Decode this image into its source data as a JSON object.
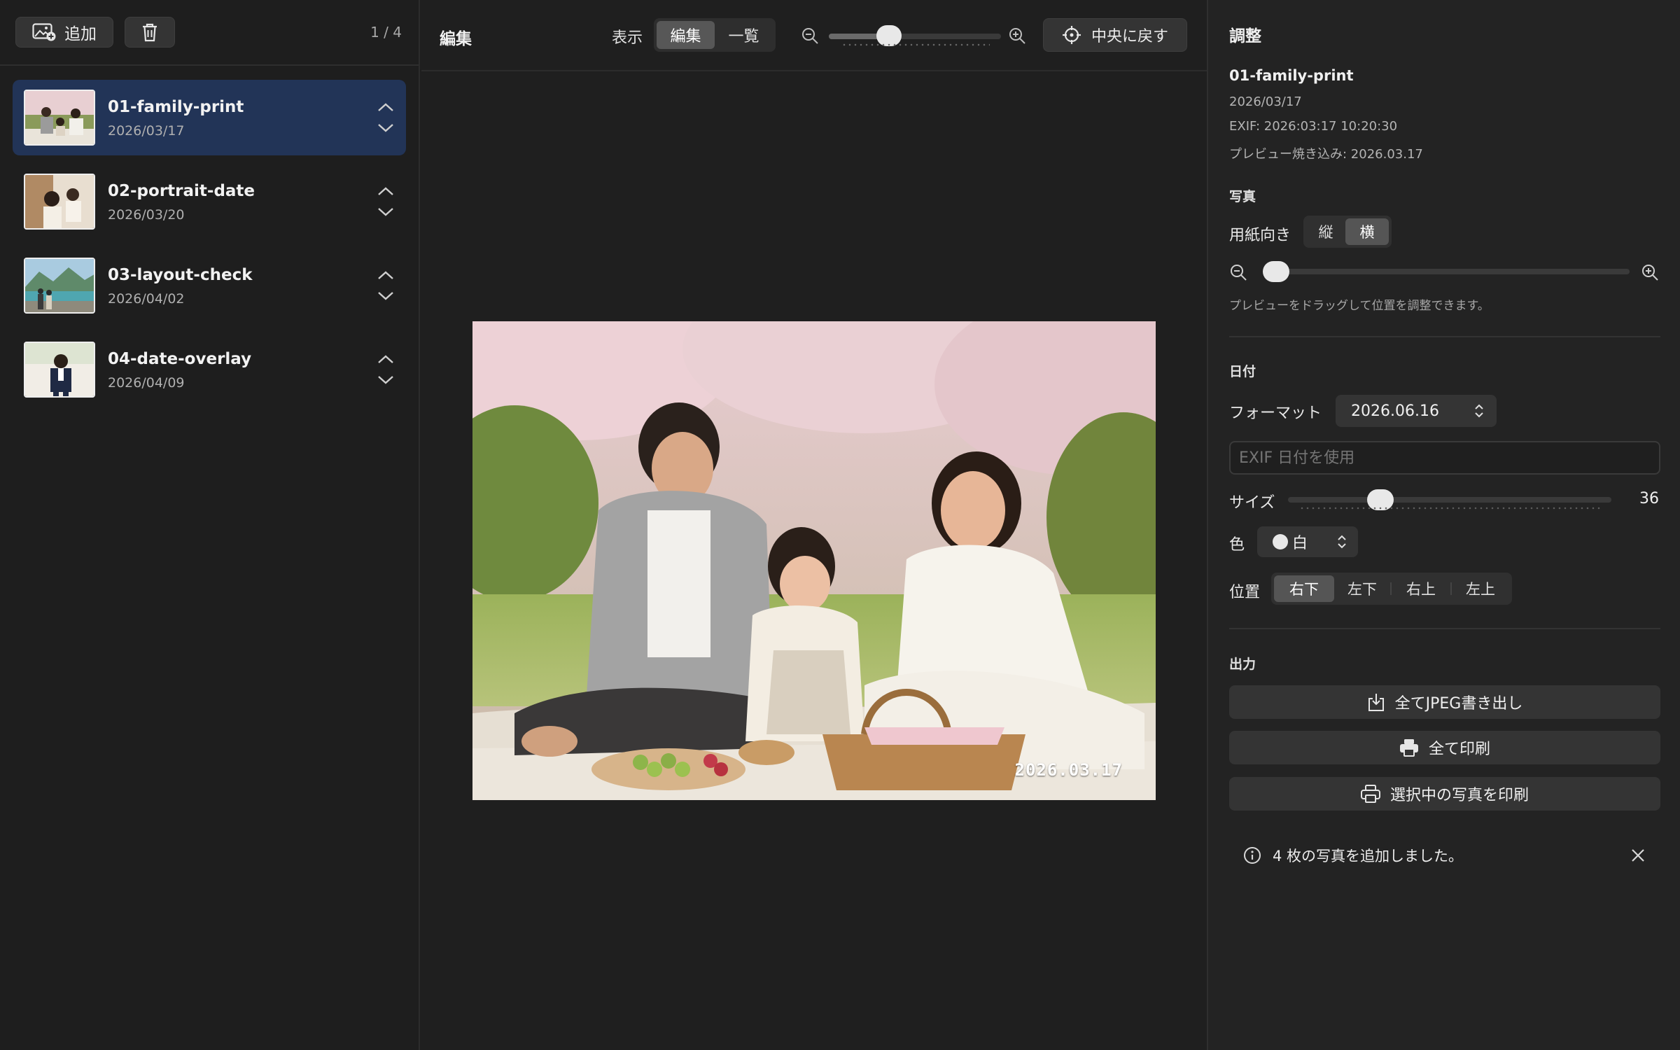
{
  "sidebar": {
    "add_label": "追加",
    "counter": "1 / 4",
    "items": [
      {
        "name": "01-family-print",
        "date": "2026/03/17"
      },
      {
        "name": "02-portrait-date",
        "date": "2026/03/20"
      },
      {
        "name": "03-layout-check",
        "date": "2026/04/02"
      },
      {
        "name": "04-date-overlay",
        "date": "2026/04/09"
      }
    ]
  },
  "center": {
    "title": "編集",
    "view_label": "表示",
    "view_options": [
      "編集",
      "一覧"
    ],
    "selected_view": "編集",
    "zoom_level": 0.35,
    "center_button": "中央に戻す",
    "photo_date": "2026.03.17"
  },
  "panel": {
    "title": "調整",
    "file_name": "01-family-print",
    "file_date": "2026/03/17",
    "exif": "EXIF: 2026:03:17 10:20:30",
    "preview_baked": "プレビュー焼き込み: 2026.03.17",
    "photo_section": "写真",
    "orientation_label": "用紙向き",
    "orientation_options": [
      "縦",
      "横"
    ],
    "selected_orientation": "横",
    "photo_zoom_level": 0,
    "drag_hint": "プレビューをドラッグして位置を調整できます。",
    "date_section": "日付",
    "format_label": "フォーマット",
    "format_value": "2026.06.16",
    "exif_placeholder": "EXIF 日付を使用",
    "size_label": "サイズ",
    "size_value": "36",
    "color_label": "色",
    "color_value": "白",
    "position_label": "位置",
    "position_options": [
      "右下",
      "左下",
      "右上",
      "左上"
    ],
    "selected_position": "右下",
    "output_section": "出力",
    "export_jpeg": "全てJPEG書き出し",
    "print_all": "全て印刷",
    "print_selected": "選択中の写真を印刷",
    "toast_message": "4 枚の写真を追加しました。"
  },
  "colors": {
    "selection": "#223457",
    "accent_knob": "#e8e8e8",
    "background": "#1e1e1e"
  }
}
